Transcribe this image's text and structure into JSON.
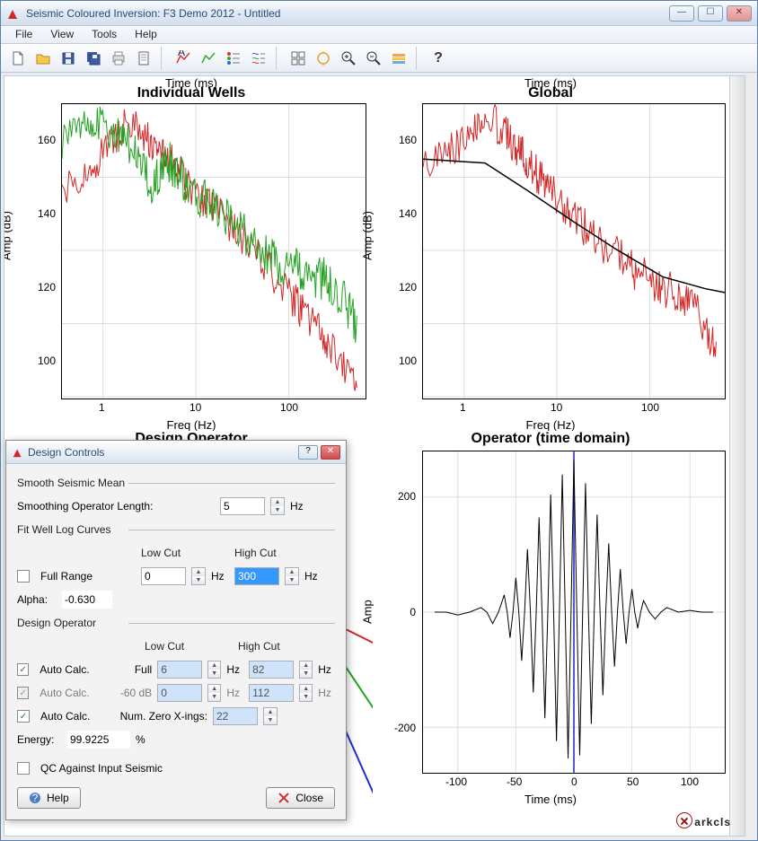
{
  "window": {
    "title": "Seismic Coloured Inversion: F3 Demo 2012 - Untitled",
    "menu": [
      "File",
      "View",
      "Tools",
      "Help"
    ],
    "toolbar_icons": [
      "new-file",
      "open-folder",
      "save",
      "save-all",
      "print",
      "document",
      "sep",
      "fit-spectrum",
      "fit-well",
      "list-colors",
      "list-lines",
      "sep",
      "grid-view",
      "process-1",
      "zoom-in",
      "zoom-out",
      "stack",
      "sep",
      "help"
    ]
  },
  "panels": {
    "tl": {
      "title": "Individual Wells",
      "xlabel": "Freq (Hz)",
      "ylabel": "Amp (dB)",
      "time_ms": "Time (ms)",
      "xticks": [
        "1",
        "10",
        "100"
      ],
      "yticks": [
        "160",
        "140",
        "120",
        "100"
      ]
    },
    "tr": {
      "title": "Global",
      "xlabel": "Freq (Hz)",
      "ylabel": "Amp (dB)",
      "time_ms": "Time (ms)",
      "xticks": [
        "1",
        "10",
        "100"
      ],
      "yticks": [
        "160",
        "140",
        "120",
        "100"
      ]
    },
    "bl": {
      "title": "Design Operator"
    },
    "br": {
      "title": "Operator (time domain)",
      "xlabel": "Time (ms)",
      "ylabel": "Amp",
      "xticks": [
        "-100",
        "-50",
        "0",
        "50",
        "100"
      ],
      "yticks": [
        "200",
        "0",
        "-200"
      ]
    }
  },
  "dialog": {
    "title": "Design Controls",
    "sections": {
      "smooth": {
        "heading": "Smooth Seismic Mean",
        "length_label": "Smoothing Operator Length:",
        "length_value": "5",
        "length_unit": "Hz"
      },
      "fit": {
        "heading": "Fit Well Log Curves",
        "full_range": "Full Range",
        "full_range_checked": false,
        "lowcut_label": "Low Cut",
        "highcut_label": "High Cut",
        "lowcut_value": "0",
        "highcut_value": "300",
        "hz": "Hz",
        "alpha_label": "Alpha:",
        "alpha_value": "-0.630"
      },
      "design": {
        "heading": "Design Operator",
        "lowcut_label": "Low Cut",
        "highcut_label": "High Cut",
        "auto_calc": "Auto Calc.",
        "row1": {
          "checked": true,
          "lbl": "Full",
          "low": "6",
          "high": "82",
          "hz": "Hz"
        },
        "row2": {
          "checked": true,
          "disabled": true,
          "lbl": "-60 dB",
          "low": "0",
          "high": "112",
          "hz": "Hz"
        },
        "row3": {
          "checked": true,
          "lbl": "Num. Zero X-ings:",
          "val": "22"
        },
        "energy_label": "Energy:",
        "energy_value": "99.9225",
        "energy_unit": "%",
        "qc_label": "QC Against Input Seismic",
        "qc_checked": false
      }
    },
    "buttons": {
      "help": "Help",
      "close": "Close"
    }
  },
  "brand": {
    "text": "arkcls"
  },
  "chart_data": [
    {
      "panel": "tl",
      "name": "Individual Wells",
      "type": "line",
      "xlabel": "Freq (Hz)",
      "ylabel": "Amp (dB)",
      "xscale": "log",
      "xlim": [
        0.2,
        500
      ],
      "ylim": [
        90,
        170
      ],
      "series": [
        {
          "name": "red",
          "color": "#d22626",
          "xy": [
            [
              0.2,
              147
            ],
            [
              0.5,
              155
            ],
            [
              1,
              165
            ],
            [
              2,
              160
            ],
            [
              3,
              156
            ],
            [
              5,
              148
            ],
            [
              10,
              141
            ],
            [
              20,
              134
            ],
            [
              50,
              122
            ],
            [
              100,
              113
            ],
            [
              200,
              104
            ],
            [
              400,
              92
            ]
          ]
        },
        {
          "name": "green",
          "color": "#21a221",
          "xy": [
            [
              0.2,
              160
            ],
            [
              0.5,
              165
            ],
            [
              1,
              160
            ],
            [
              2,
              147
            ],
            [
              3,
              155
            ],
            [
              5,
              148
            ],
            [
              10,
              141
            ],
            [
              20,
              135
            ],
            [
              50,
              127
            ],
            [
              100,
              124
            ],
            [
              200,
              122
            ],
            [
              400,
              110
            ]
          ]
        }
      ]
    },
    {
      "panel": "tr",
      "name": "Global",
      "type": "line",
      "xlabel": "Freq (Hz)",
      "ylabel": "Amp (dB)",
      "xscale": "log",
      "xlim": [
        0.2,
        500
      ],
      "ylim": [
        95,
        170
      ],
      "series": [
        {
          "name": "red",
          "color": "#d22626",
          "xy": [
            [
              0.2,
              156
            ],
            [
              0.5,
              160
            ],
            [
              1,
              167
            ],
            [
              2,
              160
            ],
            [
              3,
              155
            ],
            [
              5,
              148
            ],
            [
              10,
              141
            ],
            [
              20,
              134
            ],
            [
              50,
              127
            ],
            [
              100,
              123
            ],
            [
              200,
              120
            ],
            [
              400,
              106
            ]
          ]
        },
        {
          "name": "black",
          "color": "#000000",
          "xy": [
            [
              0.2,
              156
            ],
            [
              1,
              155
            ],
            [
              3,
              148
            ],
            [
              10,
              140
            ],
            [
              30,
              133
            ],
            [
              100,
              126
            ],
            [
              300,
              123
            ],
            [
              500,
              122
            ]
          ]
        }
      ]
    },
    {
      "panel": "br",
      "name": "Operator (time domain)",
      "type": "line",
      "xlabel": "Time (ms)",
      "ylabel": "Amp",
      "xlim": [
        -130,
        130
      ],
      "ylim": [
        -280,
        280
      ],
      "series": [
        {
          "name": "operator",
          "color": "#000000",
          "xy": [
            [
              -120,
              0
            ],
            [
              -100,
              -5
            ],
            [
              -80,
              8
            ],
            [
              -70,
              -20
            ],
            [
              -60,
              30
            ],
            [
              -55,
              -45
            ],
            [
              -50,
              60
            ],
            [
              -45,
              -85
            ],
            [
              -40,
              110
            ],
            [
              -35,
              -140
            ],
            [
              -30,
              165
            ],
            [
              -25,
              -185
            ],
            [
              -20,
              205
            ],
            [
              -15,
              -225
            ],
            [
              -10,
              240
            ],
            [
              -5,
              -255
            ],
            [
              0,
              265
            ],
            [
              5,
              -250
            ],
            [
              10,
              225
            ],
            [
              15,
              -195
            ],
            [
              20,
              170
            ],
            [
              25,
              -145
            ],
            [
              30,
              120
            ],
            [
              35,
              -95
            ],
            [
              40,
              75
            ],
            [
              45,
              -55
            ],
            [
              50,
              40
            ],
            [
              55,
              -28
            ],
            [
              60,
              20
            ],
            [
              70,
              -12
            ],
            [
              80,
              8
            ],
            [
              100,
              3
            ],
            [
              120,
              0
            ]
          ]
        },
        {
          "name": "marker",
          "color": "#2020c0",
          "xy": [
            [
              0,
              -280
            ],
            [
              0,
              280
            ]
          ]
        }
      ]
    }
  ]
}
